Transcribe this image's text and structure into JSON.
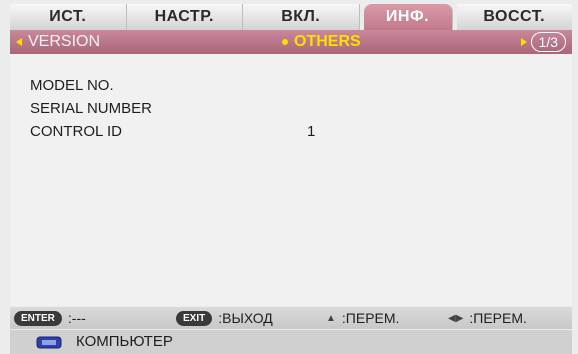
{
  "tabs": [
    "ИСТ.",
    "НАСТР.",
    "ВКЛ.",
    "ИНФ.",
    "ВОССТ."
  ],
  "active_tab": "ИНФ.",
  "subbar": {
    "left_label": "VERSION",
    "center_label": "OTHERS",
    "page_indicator": "1/3"
  },
  "rows": [
    {
      "label": "MODEL NO.",
      "value": ""
    },
    {
      "label": "SERIAL NUMBER",
      "value": ""
    },
    {
      "label": "CONTROL ID",
      "value": "1"
    }
  ],
  "help": {
    "enter_key": "ENTER",
    "enter_text": ":---",
    "exit_key": "EXIT",
    "exit_text": ":ВЫХОД",
    "updown_text": ":ПЕРЕМ.",
    "leftright_text": ":ПЕРЕМ."
  },
  "source": {
    "label": "КОМПЬЮТЕР",
    "icon": "monitor-icon"
  },
  "colors": {
    "accent": "#b97282",
    "highlight": "#ffdd00"
  }
}
